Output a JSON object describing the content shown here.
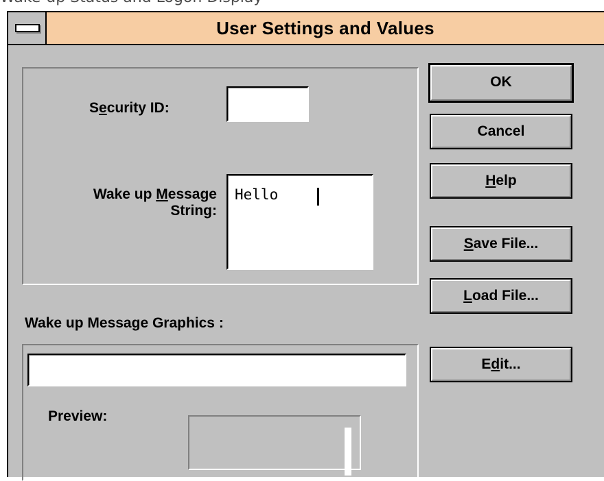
{
  "caption": "Wake-up Status and Logon Display",
  "window": {
    "title": "User Settings and Values"
  },
  "security": {
    "label_pre": "S",
    "label_ul": "e",
    "label_post": "curity ID:",
    "value": ""
  },
  "wake_message": {
    "label_line1_pre": "Wake up ",
    "label_line1_ul": "M",
    "label_line1_post": "essage",
    "label_line2": "String:",
    "value": "Hello"
  },
  "graphics": {
    "label": "Wake up Message Graphics :",
    "path_value": "",
    "preview_label": "Preview:"
  },
  "buttons": {
    "ok": "OK",
    "cancel": "Cancel",
    "help_ul": "H",
    "help_rest": "elp",
    "save_ul": "S",
    "save_rest": "ave File...",
    "load_ul": "L",
    "load_rest": "oad File...",
    "edit_pre": "E",
    "edit_ul": "d",
    "edit_rest": "it..."
  },
  "icons": {
    "system_menu": "system-menu-icon"
  },
  "colors": {
    "titlebar": "#f7cda3",
    "face": "#c0c0c0"
  }
}
